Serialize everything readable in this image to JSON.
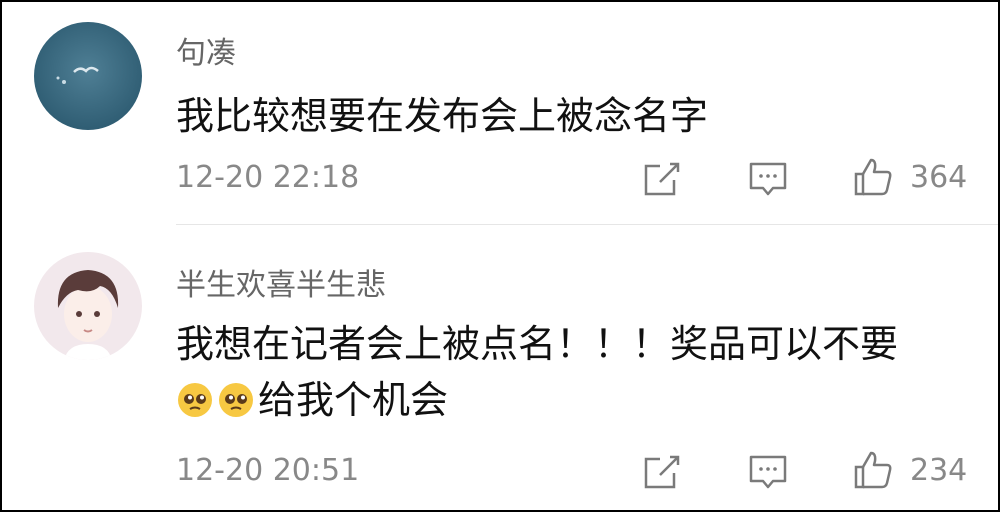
{
  "comments": [
    {
      "username": "句凑",
      "text_lines": [
        "我比较想要在发布会上被念名字"
      ],
      "time": "12-20 22:18",
      "likes": "364",
      "avatar_icon": "sky-bird-avatar-icon"
    },
    {
      "username": "半生欢喜半生悲",
      "text_lines": [
        "我想在记者会上被点名！！！奖品可以不要",
        "给我个机会"
      ],
      "emojis": [
        "pleading-face-icon",
        "pleading-face-icon"
      ],
      "time": "12-20 20:51",
      "likes": "234",
      "avatar_icon": "anime-boy-avatar-icon"
    }
  ],
  "icons": {
    "share": "share-icon",
    "reply": "comment-icon",
    "like": "thumbs-up-icon"
  },
  "colors": {
    "username": "#666666",
    "text": "#111111",
    "meta": "#888888",
    "icon_stroke": "#7a7a7a"
  }
}
